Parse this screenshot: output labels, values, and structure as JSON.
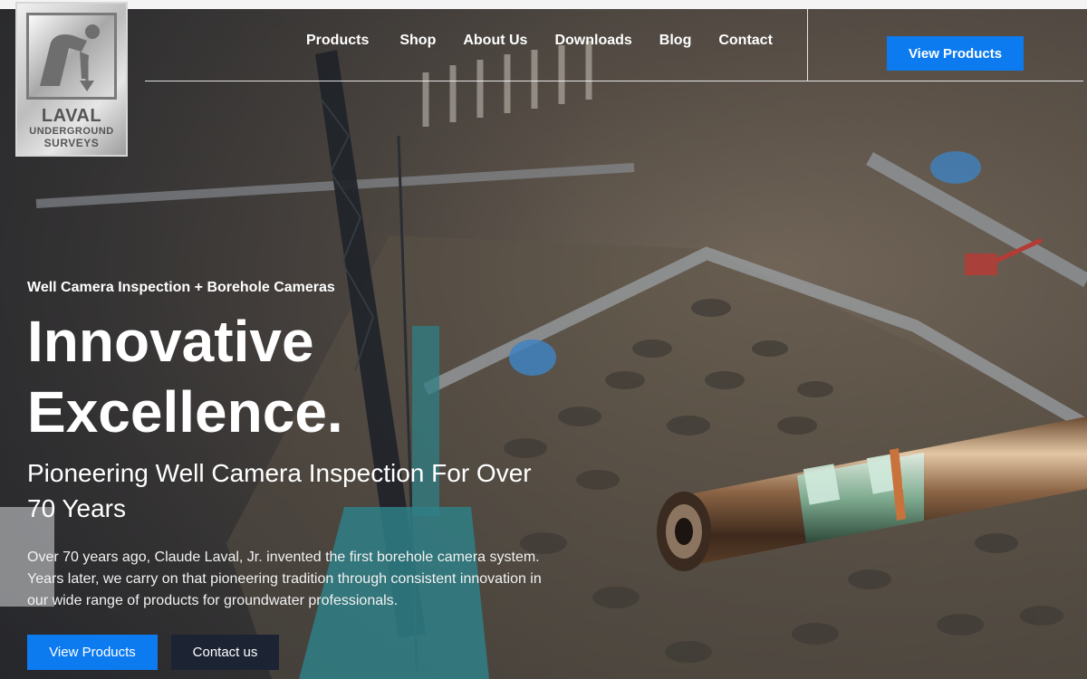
{
  "brand": {
    "logo_line1": "LAVAL",
    "logo_line2": "UNDERGROUND",
    "logo_line3": "SURVEYS"
  },
  "nav": {
    "items": [
      {
        "label": "Products"
      },
      {
        "label": "Shop"
      },
      {
        "label": "About Us"
      },
      {
        "label": "Downloads"
      },
      {
        "label": "Blog"
      },
      {
        "label": "Contact"
      }
    ],
    "cta_label": "View Products"
  },
  "hero": {
    "eyebrow": "Well Camera Inspection + Borehole Cameras",
    "headline_line1": "Innovative",
    "headline_line2": "Excellence.",
    "subheadline": "Pioneering Well Camera Inspection For Over 70 Years",
    "body": "Over 70 years ago, Claude Laval, Jr. invented the first borehole camera system. Years later, we carry on that pioneering tradition through consistent innovation in our wide range of products for groundwater professionals.",
    "primary_button": "View Products",
    "secondary_button": "Contact us"
  },
  "colors": {
    "accent": "#0d7bf0",
    "dark_button": "#1c2333"
  }
}
